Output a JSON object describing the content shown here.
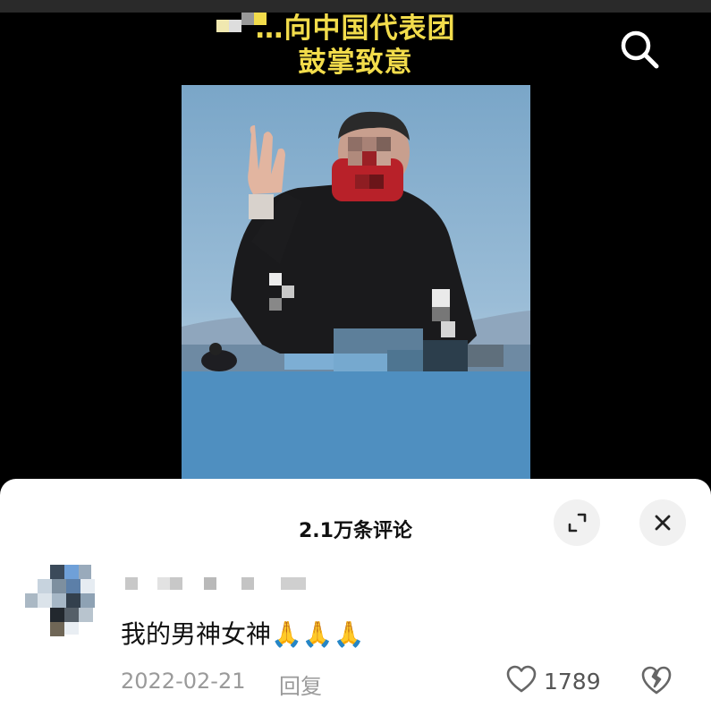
{
  "video": {
    "caption_line1": "…向中国代表团",
    "caption_line2": "鼓掌致意",
    "search_icon": "search-icon"
  },
  "comments_panel": {
    "title": "2.1万条评论",
    "expand_icon": "expand-icon",
    "close_icon": "close-icon",
    "comment": {
      "username": "",
      "text": "我的男神女神🙏🙏🙏",
      "date": "2022-02-21",
      "reply_label": "回复",
      "like_count": "1789",
      "like_icon": "heart-outline-icon",
      "dislike_icon": "broken-heart-icon"
    }
  },
  "colors": {
    "caption_yellow": "#f2dc4b",
    "panel_bg": "#ffffff",
    "muted_text": "#9a9a9a"
  }
}
